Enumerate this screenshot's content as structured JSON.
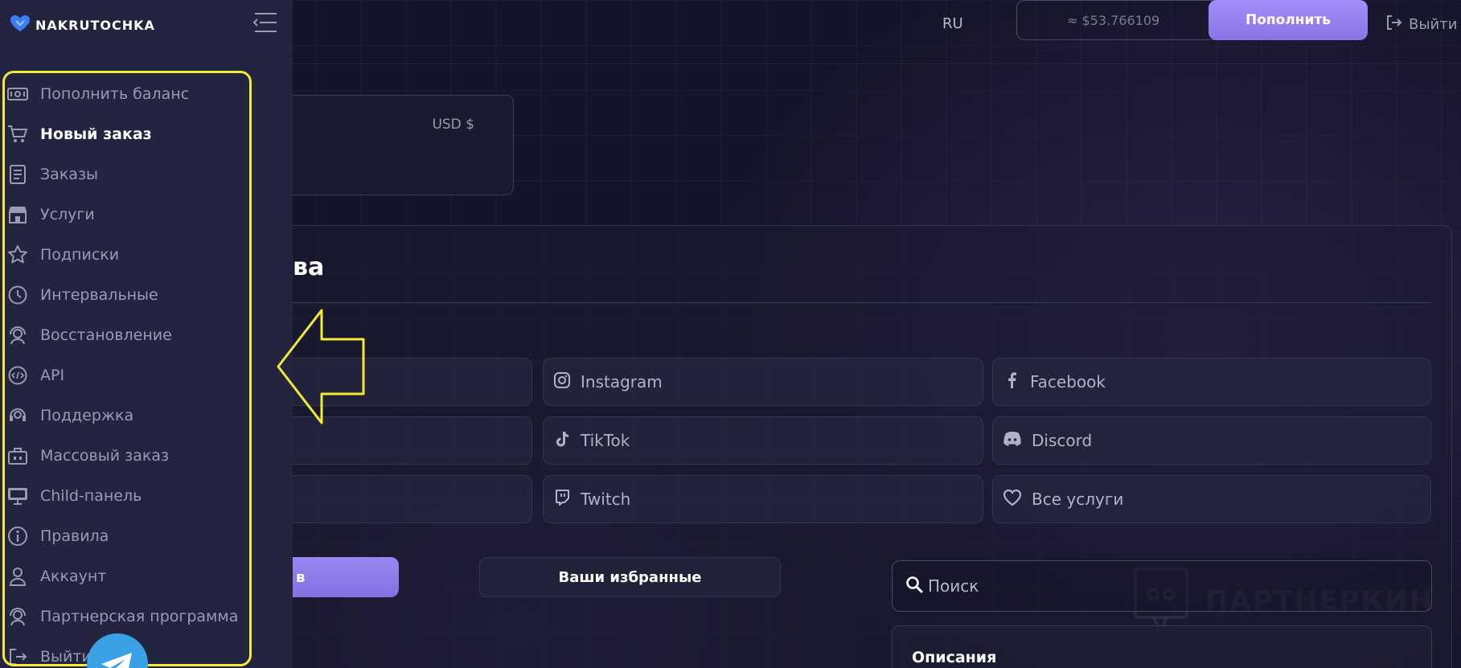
{
  "header": {
    "language": "RU",
    "balance": "≈ $53.766109",
    "topup_label": "Пополнить",
    "logout_label": "Выйти"
  },
  "sidebar": {
    "brand": "NAKRUTOCHKA",
    "items": [
      {
        "label": "Пополнить баланс",
        "icon": "cash-icon",
        "active": false
      },
      {
        "label": "Новый заказ",
        "icon": "cart-icon",
        "active": true
      },
      {
        "label": "Заказы",
        "icon": "document-icon",
        "active": false
      },
      {
        "label": "Услуги",
        "icon": "store-icon",
        "active": false
      },
      {
        "label": "Подписки",
        "icon": "star-icon",
        "active": false
      },
      {
        "label": "Интервальные",
        "icon": "clock-icon",
        "active": false
      },
      {
        "label": "Восстановление",
        "icon": "support-agent-icon",
        "active": false
      },
      {
        "label": "API",
        "icon": "code-icon",
        "active": false
      },
      {
        "label": "Поддержка",
        "icon": "headset-icon",
        "active": false
      },
      {
        "label": "Массовый заказ",
        "icon": "briefcase-icon",
        "active": false
      },
      {
        "label": "Child-панель",
        "icon": "monitor-icon",
        "active": false
      },
      {
        "label": "Правила",
        "icon": "info-icon",
        "active": false
      },
      {
        "label": "Аккаунт",
        "icon": "user-icon",
        "active": false
      },
      {
        "label": "Партнерская программа",
        "icon": "partner-icon",
        "active": false
      },
      {
        "label": "Выйти",
        "icon": "logout-icon",
        "active": false
      }
    ]
  },
  "currency": {
    "label": "USD $"
  },
  "main": {
    "title_fragment": "ва",
    "categories": [
      {
        "label": "Instagram",
        "icon": "instagram-icon"
      },
      {
        "label": "Facebook",
        "icon": "facebook-icon"
      },
      {
        "label": "TikTok",
        "icon": "tiktok-icon"
      },
      {
        "label": "Discord",
        "icon": "discord-icon"
      },
      {
        "label": "Twitch",
        "icon": "twitch-icon"
      },
      {
        "label": "Все услуги",
        "icon": "heart-icon"
      }
    ],
    "purple_button_fragment": "в",
    "favorites_label": "Ваши избранные",
    "search_placeholder": "Поиск",
    "watermark": "ПАРТНЕРКИН",
    "description_title": "Описания"
  },
  "colors": {
    "accent": "#9a86f2",
    "highlight": "#f2ea3a",
    "sidebar_bg": "#222440",
    "page_bg": "#15152a"
  }
}
